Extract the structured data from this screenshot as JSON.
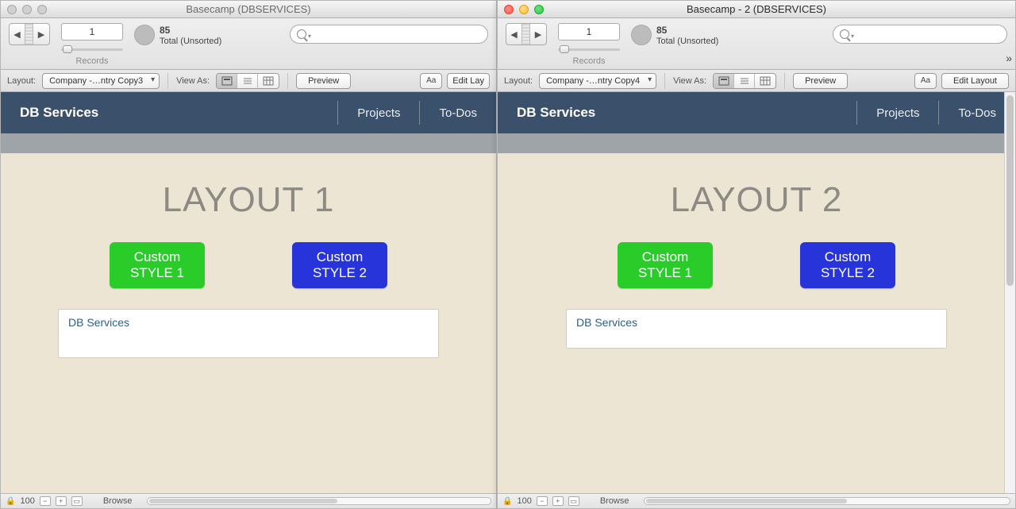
{
  "windows": [
    {
      "id": "left",
      "active": false,
      "title": "Basecamp (DBSERVICES)",
      "record_number": "1",
      "total_count": "85",
      "total_label": "Total (Unsorted)",
      "records_label": "Records",
      "layout_label": "Layout:",
      "layout_value": "Company -…ntry Copy3",
      "viewas_label": "View As:",
      "preview_label": "Preview",
      "aa_label": "Aa",
      "edit_layout_label": "Edit Lay",
      "brand": "DB Services",
      "nav_projects": "Projects",
      "nav_todos": "To-Dos",
      "heading": "LAYOUT 1",
      "btn1_line1": "Custom",
      "btn1_line2": "STYLE 1",
      "btn2_line1": "Custom",
      "btn2_line2": "STYLE 2",
      "card_text": "DB Services",
      "zoom": "100",
      "mode": "Browse"
    },
    {
      "id": "right",
      "active": true,
      "title": "Basecamp - 2 (DBSERVICES)",
      "record_number": "1",
      "total_count": "85",
      "total_label": "Total (Unsorted)",
      "records_label": "Records",
      "layout_label": "Layout:",
      "layout_value": "Company -…ntry Copy4",
      "viewas_label": "View As:",
      "preview_label": "Preview",
      "aa_label": "Aa",
      "edit_layout_label": "Edit Layout",
      "brand": "DB Services",
      "nav_projects": "Projects",
      "nav_todos": "To-Dos",
      "heading": "LAYOUT 2",
      "btn1_line1": "Custom",
      "btn1_line2": "STYLE 1",
      "btn2_line1": "Custom",
      "btn2_line2": "STYLE 2",
      "card_text": "DB Services",
      "zoom": "100",
      "mode": "Browse"
    }
  ]
}
